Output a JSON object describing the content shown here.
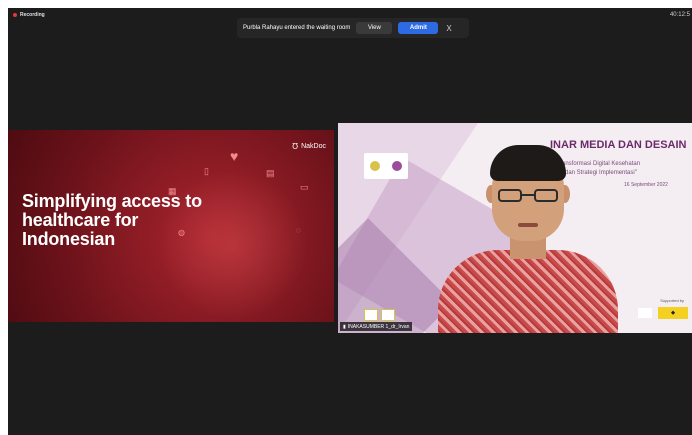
{
  "topbar": {
    "recording_label": "Recording",
    "clock": "40:12:5"
  },
  "notification": {
    "message": "Purbla Rahayu entered the waiting room",
    "view_label": "View",
    "admit_label": "Admit",
    "close_label": "X"
  },
  "slide": {
    "title": "Simplifying access to healthcare for Indonesian",
    "brand": "NakDoc"
  },
  "banner": {
    "title": "INAR MEDIA DAN DESAIN",
    "subtitle_line1": "ransformasi Digital Kesehatan",
    "subtitle_line2": "n dan Strategi Implementasi\"",
    "date": "16 September 2022",
    "supported_by": "Supported by"
  },
  "participant": {
    "name_tag": "INAKASUMBER 1_dr_Irvan"
  },
  "colors": {
    "background": "#1c1c1c",
    "admit": "#2d6ae3",
    "slide_red": "#8e1c25",
    "banner_purple": "#6b2b6b"
  }
}
